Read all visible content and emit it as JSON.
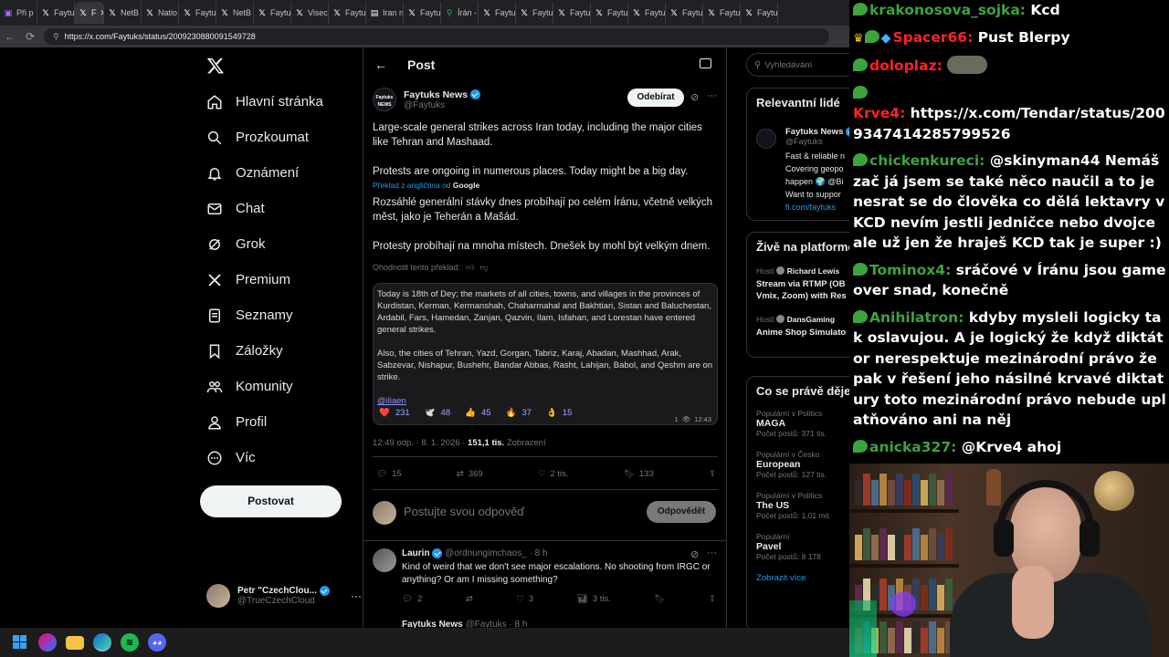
{
  "browser": {
    "tabs": [
      {
        "icon": "twitch",
        "label": "Při p"
      },
      {
        "icon": "x",
        "label": "Faytu"
      },
      {
        "icon": "x",
        "label": "F",
        "active": true
      },
      {
        "icon": "x",
        "label": "NetB"
      },
      {
        "icon": "x",
        "label": "Natio"
      },
      {
        "icon": "x",
        "label": "Faytu"
      },
      {
        "icon": "x",
        "label": "NetB"
      },
      {
        "icon": "x",
        "label": "Faytu"
      },
      {
        "icon": "x",
        "label": "Visec"
      },
      {
        "icon": "x",
        "label": "Faytu"
      },
      {
        "icon": "page",
        "label": "Iran n"
      },
      {
        "icon": "x",
        "label": "Faytu"
      },
      {
        "icon": "maps",
        "label": "Írán -"
      },
      {
        "icon": "x",
        "label": "Faytu"
      },
      {
        "icon": "x",
        "label": "Faytu"
      },
      {
        "icon": "x",
        "label": "Faytu"
      },
      {
        "icon": "x",
        "label": "Faytu"
      },
      {
        "icon": "x",
        "label": "Faytu"
      },
      {
        "icon": "x",
        "label": "Faytu"
      },
      {
        "icon": "x",
        "label": "Faytu"
      },
      {
        "icon": "x",
        "label": "Faytu"
      }
    ],
    "url": "https://x.com/Faytuks/status/2009230880091549728"
  },
  "nav": {
    "items": [
      {
        "label": "Hlavní stránka",
        "icon": "home-icon"
      },
      {
        "label": "Prozkoumat",
        "icon": "search-icon"
      },
      {
        "label": "Oznámení",
        "icon": "bell-icon"
      },
      {
        "label": "Chat",
        "icon": "mail-icon"
      },
      {
        "label": "Grok",
        "icon": "grok-icon"
      },
      {
        "label": "Premium",
        "icon": "x-premium-icon"
      },
      {
        "label": "Seznamy",
        "icon": "list-icon"
      },
      {
        "label": "Záložky",
        "icon": "bookmark-icon"
      },
      {
        "label": "Komunity",
        "icon": "communities-icon"
      },
      {
        "label": "Profil",
        "icon": "profile-icon"
      },
      {
        "label": "Víc",
        "icon": "more-circle-icon"
      }
    ],
    "post_button": "Postovat",
    "account": {
      "name": "Petr \"CzechClou...",
      "handle": "@TrueCzechCloud"
    }
  },
  "post": {
    "header": "Post",
    "author": {
      "name": "Faytuks News",
      "handle": "@Faytuks"
    },
    "follow_button": "Odebírat",
    "text_en_1": "Large-scale general strikes across Iran today, including the major cities like Tehran and Mashaad.",
    "text_en_2": "Protests are ongoing in numerous places. Today might be a big day.",
    "translation_label": "Překlad z angličtina od",
    "translation_provider": "Google",
    "text_cz_1": "Rozsáhlé generální stávky dnes probíhají po celém Íránu, včetně velkých měst, jako je Teherán a Mašád.",
    "text_cz_2": "Protesty probíhají na mnoha místech. Dnešek by mohl být velkým dnem.",
    "rate_translation": "Ohodnotit tento překlad:",
    "quote": {
      "p1": "Today is 18th of Dey; the markets of all cities, towns, and villages in the provinces of Kurdistan, Kerman, Kermanshah, Chaharmahal and Bakhtiari, Sistan and Baluchestan, Ardabil, Fars, Hamedan, Zanjan, Qazvin, Ilam, Isfahan, and Lorestan have entered general strikes.",
      "p2": "Also, the cities of Tehran, Yazd, Gorgan, Tabriz, Karaj, Abadan, Mashhad, Arak, Sabzevar, Nishapur, Bushehr, Bandar Abbas, Rasht, Lahijan, Babol, and Qeshm are on strike.",
      "mention": "@iliaen",
      "reactions": [
        {
          "emoji": "❤️",
          "count": "231"
        },
        {
          "emoji": "🕊️",
          "count": "48"
        },
        {
          "emoji": "👍",
          "count": "45"
        },
        {
          "emoji": "🔥",
          "count": "37"
        },
        {
          "emoji": "👌",
          "count": "15"
        }
      ],
      "views": "1",
      "time": "12:43"
    },
    "timestamp": "12:49 odp. · 8. 1. 2026 ·",
    "views_count": "151,1 tis.",
    "views_label": "Zobrazení",
    "stats": {
      "replies": "15",
      "reposts": "369",
      "likes": "2 tis.",
      "bookmarks": "133"
    },
    "reply_placeholder": "Postujte svou odpověď",
    "reply_button": "Odpovědět"
  },
  "reply": {
    "author": "Laurin",
    "handle": "@ordnungimchaos_",
    "age": "· 8 h",
    "text": "Kind of weird that we don't see major escalations. No shooting from IRGC or anything? Or am I missing something?",
    "stats": {
      "replies": "2",
      "reposts": "",
      "likes": "3",
      "views": "3 tis."
    },
    "next_author": "Faytuks News",
    "next_handle": "@Faytuks · 8 h"
  },
  "sidebar": {
    "search_placeholder": "Vyhledávání",
    "relevant_title": "Relevantní lidé",
    "relevant_person": {
      "name": "Faytuks News",
      "handle": "@Faytuks",
      "bio_lines": [
        "Fast & reliable n",
        "Covering geopo",
        "happen 🌍 @Bi",
        "Want to suppor",
        "fi.com/faytuks"
      ]
    },
    "live_title": "Živě na platformě",
    "live": [
      {
        "host_label": "Hostí",
        "host": "Richard Lewis",
        "title": "Stream via RTMP (OB Vmix, Zoom) with Res"
      },
      {
        "host_label": "Hostí",
        "host": "DansGaming",
        "title": "Anime Shop Simulato"
      }
    ],
    "trends_title": "Co se právě děje",
    "trends": [
      {
        "category": "Populární v Politics",
        "name": "MAGA",
        "count": "Počet postů: 371 tis."
      },
      {
        "category": "Populární v Česko",
        "name": "European",
        "count": "Počet postů: 127 tis."
      },
      {
        "category": "Populární v Politics",
        "name": "The US",
        "count": "Počet postů: 1,01 mil."
      },
      {
        "category": "Populární",
        "name": "Pavel",
        "count": "Počet postů: 8 178"
      }
    ],
    "show_more": "Zobrazit více"
  },
  "chat": {
    "messages": [
      {
        "user": "krakonosova_sojka",
        "color": "#3da33d",
        "badges": [
          "sub"
        ],
        "text": "Kcd"
      },
      {
        "user": "Spacer66",
        "color": "#ff2222",
        "badges": [
          "crown",
          "sub",
          "diamond"
        ],
        "text": "Pust Blerpy"
      },
      {
        "user": "doloplaz",
        "color": "#ff2222",
        "badges": [
          "sub"
        ],
        "text": "",
        "emote": true
      },
      {
        "user": "Krve4",
        "color": "#ff2222",
        "badges": [
          "sub"
        ],
        "text": "https://x.com/Tendar/status/2009347414285799526",
        "newline_user": true
      },
      {
        "user": "chickenkureci",
        "color": "#3da33d",
        "badges": [
          "sub"
        ],
        "text": "@skinyman44 Nemáš zač já jsem se také něco naučil a to je nesrat se do člověka co dělá lektavry v KCD nevím jestli jedničce nebo dvojce ale už jen že hraješ KCD tak je super :)"
      },
      {
        "user": "Tominox4",
        "color": "#3da33d",
        "badges": [
          "sub"
        ],
        "text": "sráčové v Íránu jsou game over snad, konečně"
      },
      {
        "user": "Anihilatron",
        "color": "#3da33d",
        "badges": [
          "sub"
        ],
        "text": "kdyby mysleli logicky tak oslavujou. A je logický že když diktátor nerespektuje mezinárodní právo že pak v řešení jeho násilné krvavé diktatury toto mezinárodní právo nebude uplatňováno ani na něj"
      },
      {
        "user": "anicka327",
        "color": "#3da33d",
        "badges": [
          "sub"
        ],
        "text": "@Krve4 ahoj"
      }
    ]
  },
  "taskbar": {
    "apps": [
      "windows-start",
      "copilot",
      "file-explorer",
      "edge",
      "spotify",
      "discord"
    ]
  },
  "colors": {
    "x_blue": "#1d9bf0",
    "bg": "#000000",
    "border": "#2f3336",
    "chat_green": "#3da33d",
    "chat_red": "#ff2222"
  }
}
